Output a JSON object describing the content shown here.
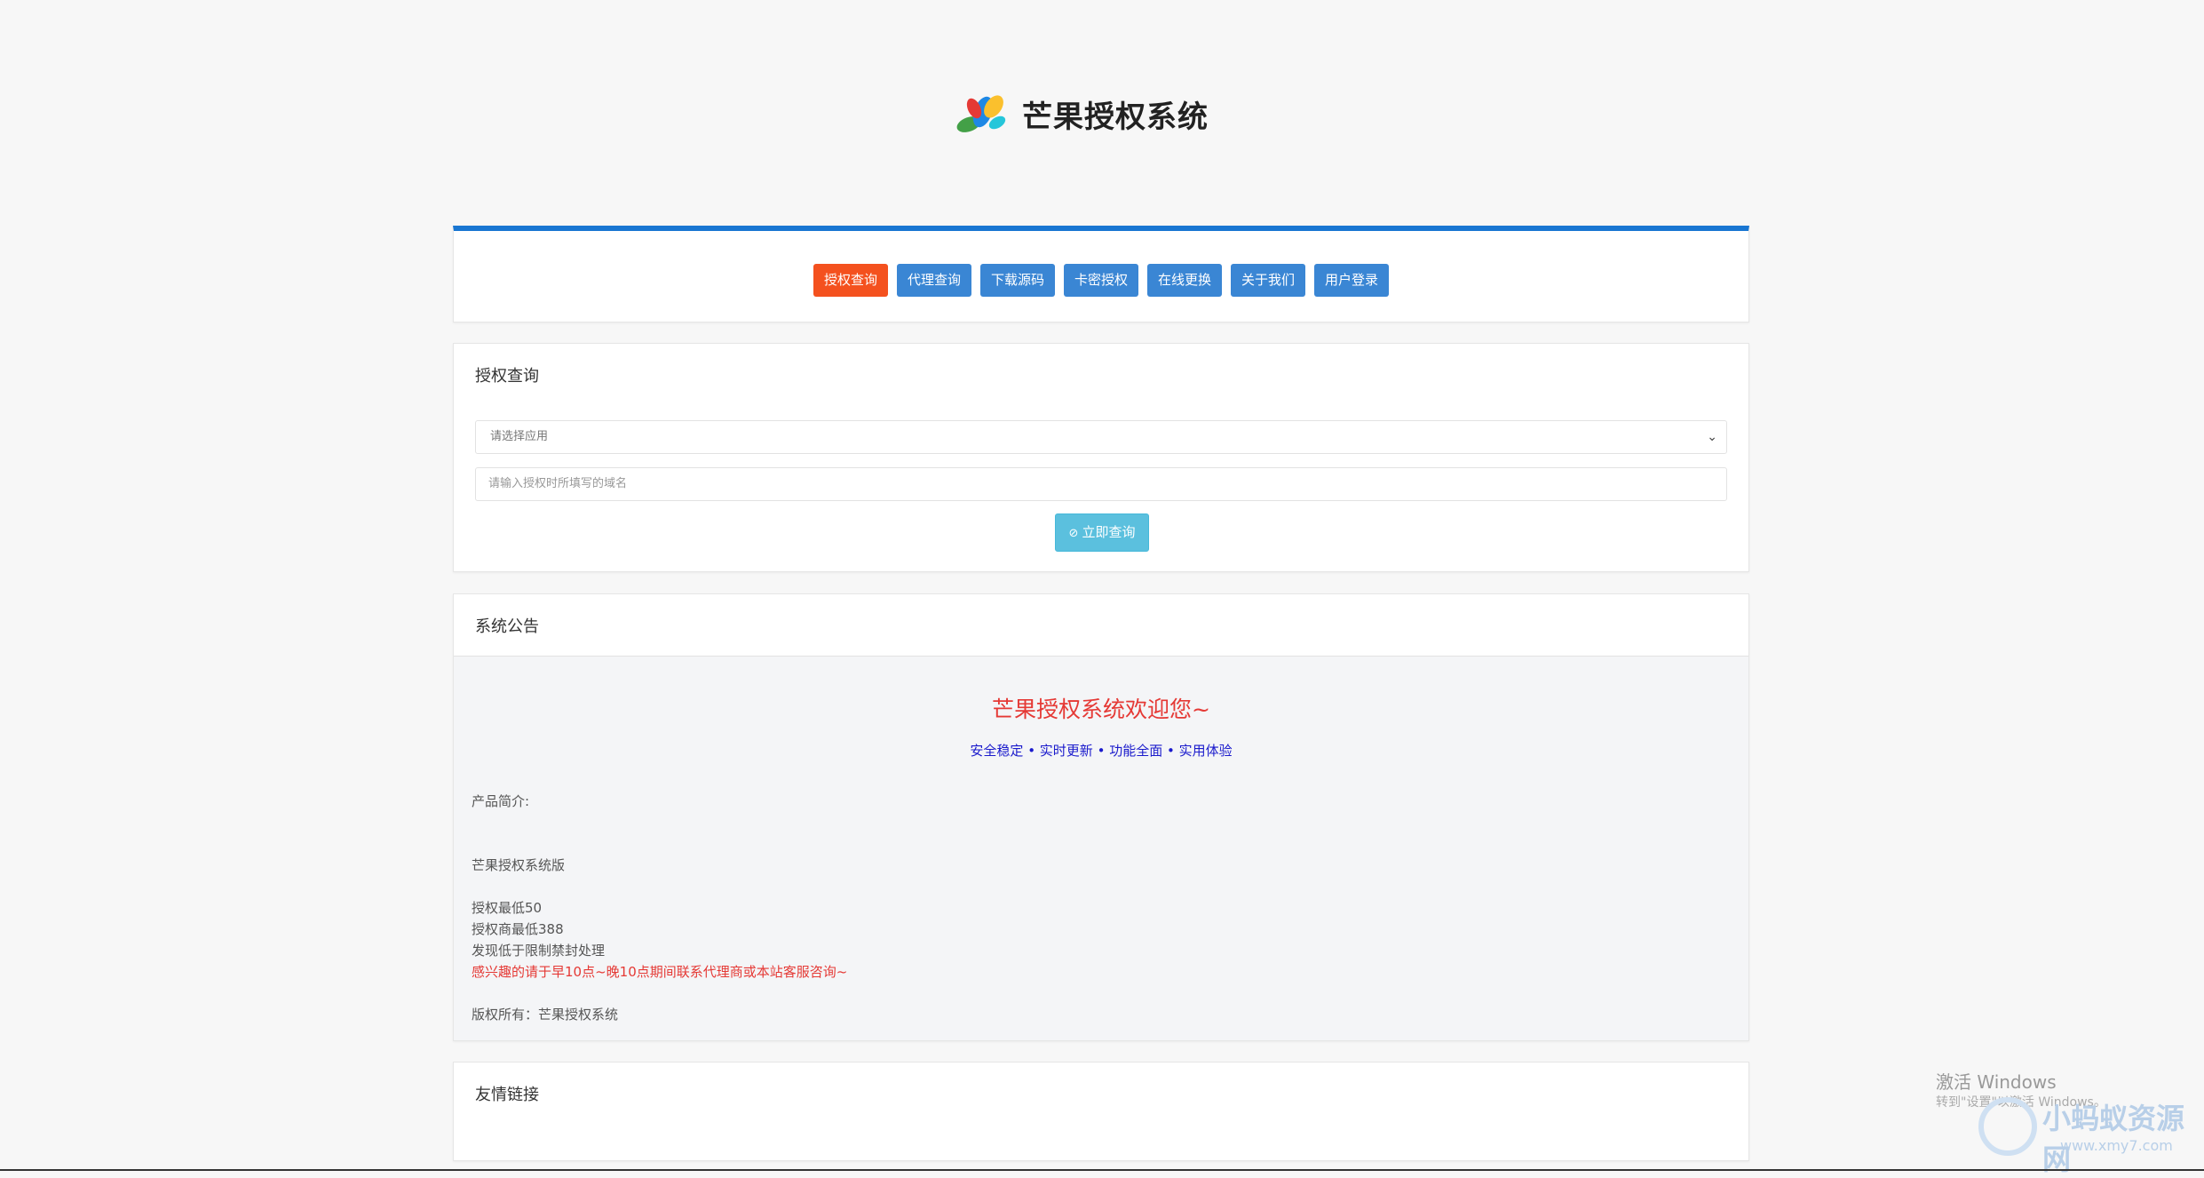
{
  "brand": {
    "title": "芒果授权系统"
  },
  "nav": {
    "items": [
      {
        "label": "授权查询",
        "active": true
      },
      {
        "label": "代理查询",
        "active": false
      },
      {
        "label": "下载源码",
        "active": false
      },
      {
        "label": "卡密授权",
        "active": false
      },
      {
        "label": "在线更换",
        "active": false
      },
      {
        "label": "关于我们",
        "active": false
      },
      {
        "label": "用户登录",
        "active": false
      }
    ],
    "accent_color": "#1976d2",
    "active_color": "#f4511e",
    "button_color": "#3a86d4"
  },
  "query": {
    "title": "授权查询",
    "select_value": "请选择应用",
    "domain_placeholder": "请输入授权时所填写的域名",
    "submit_label": "立即查询"
  },
  "notice": {
    "title": "系统公告",
    "welcome": "芒果授权系统欢迎您~",
    "tagline": "安全稳定 • 实时更新 • 功能全面 • 实用体验",
    "intro_label": "产品简介:",
    "edition": "芒果授权系统版",
    "price_min": "授权最低50",
    "agent_min": "授权商最低388",
    "policy": "发现低于限制禁封处理",
    "contact": "感兴趣的请于早10点~晚10点期间联系代理商或本站客服咨询~",
    "copyright": "版权所有：芒果授权系统"
  },
  "links": {
    "title": "友情链接"
  },
  "overlay": {
    "windows_line1": "激活 Windows",
    "windows_line2": "转到\"设置\"以激活 Windows。",
    "site_name": "小蚂蚁资源网",
    "site_url": "www.xmy7.com"
  }
}
